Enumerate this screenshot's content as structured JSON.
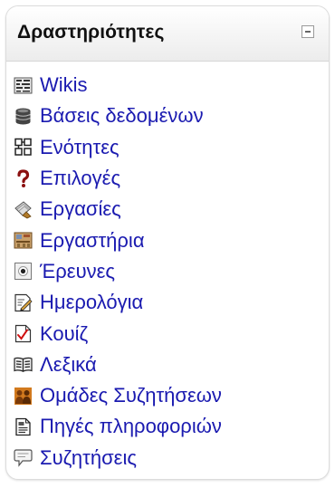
{
  "block": {
    "title": "Δραστηριότητες",
    "items": [
      {
        "label": "Wikis",
        "icon": "wiki-icon"
      },
      {
        "label": "Βάσεις δεδομένων",
        "icon": "database-icon"
      },
      {
        "label": "Ενότητες",
        "icon": "sections-icon"
      },
      {
        "label": "Επιλογές",
        "icon": "question-icon"
      },
      {
        "label": "Εργασίες",
        "icon": "assignment-icon"
      },
      {
        "label": "Εργαστήρια",
        "icon": "workshop-icon"
      },
      {
        "label": "Έρευνες",
        "icon": "survey-icon"
      },
      {
        "label": "Ημερολόγια",
        "icon": "journal-icon"
      },
      {
        "label": "Κουίζ",
        "icon": "quiz-icon"
      },
      {
        "label": "Λεξικά",
        "icon": "glossary-icon"
      },
      {
        "label": "Ομάδες Συζητήσεων",
        "icon": "forum-icon"
      },
      {
        "label": "Πηγές πληροφοριών",
        "icon": "resource-icon"
      },
      {
        "label": "Συζητήσεις",
        "icon": "chat-icon"
      }
    ]
  },
  "colors": {
    "link": "#1a1ab0",
    "title": "#111111"
  }
}
